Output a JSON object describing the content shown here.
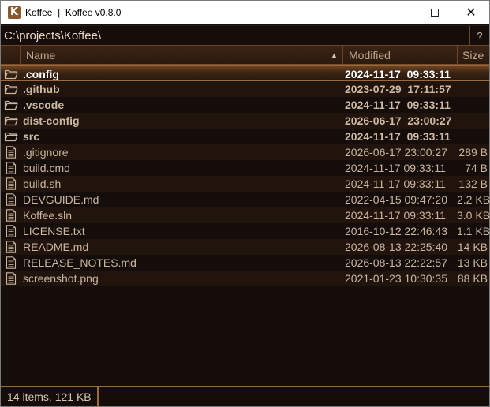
{
  "window": {
    "app_icon": "K",
    "title": "Koffee  |  Koffee v0.8.0",
    "controls": {
      "minimize": "minimize-icon",
      "maximize": "maximize-icon",
      "close": "✕"
    }
  },
  "pathbar": {
    "path": "C:\\projects\\Koffee\\",
    "help": "?"
  },
  "columns": {
    "name": "Name",
    "modified": "Modified",
    "size": "Size",
    "sort": "▲"
  },
  "colors": {
    "background": "#140d09",
    "accent": "#9a6a3c",
    "text": "#c9b5a0"
  },
  "items": [
    {
      "type": "folder",
      "name": ".config",
      "modified": "2024-11-17  09:33:11",
      "size": ""
    },
    {
      "type": "folder",
      "name": ".github",
      "modified": "2023-07-29  17:11:57",
      "size": ""
    },
    {
      "type": "folder",
      "name": ".vscode",
      "modified": "2024-11-17  09:33:11",
      "size": ""
    },
    {
      "type": "folder",
      "name": "dist-config",
      "modified": "2026-06-17  23:00:27",
      "size": ""
    },
    {
      "type": "folder",
      "name": "src",
      "modified": "2024-11-17  09:33:11",
      "size": ""
    },
    {
      "type": "file",
      "name": ".gitignore",
      "modified": "2026-06-17 23:00:27",
      "size": "289 B"
    },
    {
      "type": "file",
      "name": "build.cmd",
      "modified": "2024-11-17 09:33:11",
      "size": "74 B"
    },
    {
      "type": "file",
      "name": "build.sh",
      "modified": "2024-11-17 09:33:11",
      "size": "132 B"
    },
    {
      "type": "file",
      "name": "DEVGUIDE.md",
      "modified": "2022-04-15 09:47:20",
      "size": "2.2 KB"
    },
    {
      "type": "file",
      "name": "Koffee.sln",
      "modified": "2024-11-17 09:33:11",
      "size": "3.0 KB"
    },
    {
      "type": "file",
      "name": "LICENSE.txt",
      "modified": "2016-10-12 22:46:43",
      "size": "1.1 KB"
    },
    {
      "type": "file",
      "name": "README.md",
      "modified": "2026-08-13 22:25:40",
      "size": "14 KB"
    },
    {
      "type": "file",
      "name": "RELEASE_NOTES.md",
      "modified": "2026-08-13 22:22:57",
      "size": "13 KB"
    },
    {
      "type": "file",
      "name": "screenshot.png",
      "modified": "2021-01-23 10:30:35",
      "size": "88 KB"
    }
  ],
  "selected_index": 0,
  "status": {
    "text": "14 items, 121 KB"
  }
}
